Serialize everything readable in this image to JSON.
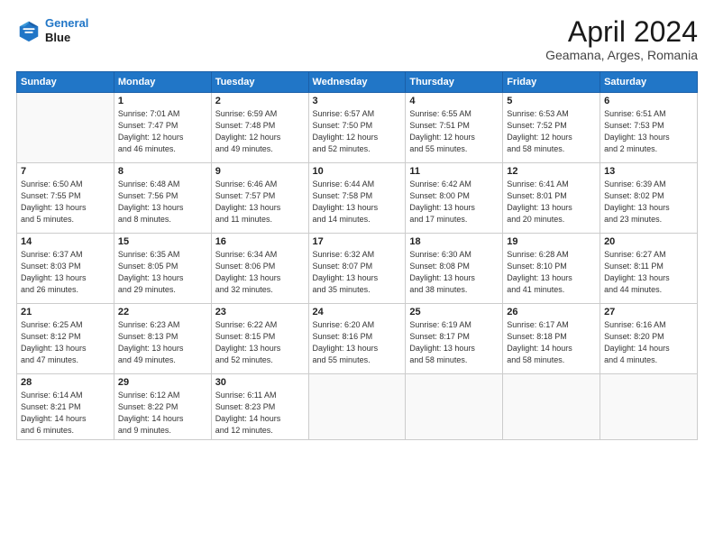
{
  "header": {
    "logo_line1": "General",
    "logo_line2": "Blue",
    "title": "April 2024",
    "subtitle": "Geamana, Arges, Romania"
  },
  "days_of_week": [
    "Sunday",
    "Monday",
    "Tuesday",
    "Wednesday",
    "Thursday",
    "Friday",
    "Saturday"
  ],
  "weeks": [
    [
      {
        "day": "",
        "info": ""
      },
      {
        "day": "1",
        "info": "Sunrise: 7:01 AM\nSunset: 7:47 PM\nDaylight: 12 hours\nand 46 minutes."
      },
      {
        "day": "2",
        "info": "Sunrise: 6:59 AM\nSunset: 7:48 PM\nDaylight: 12 hours\nand 49 minutes."
      },
      {
        "day": "3",
        "info": "Sunrise: 6:57 AM\nSunset: 7:50 PM\nDaylight: 12 hours\nand 52 minutes."
      },
      {
        "day": "4",
        "info": "Sunrise: 6:55 AM\nSunset: 7:51 PM\nDaylight: 12 hours\nand 55 minutes."
      },
      {
        "day": "5",
        "info": "Sunrise: 6:53 AM\nSunset: 7:52 PM\nDaylight: 12 hours\nand 58 minutes."
      },
      {
        "day": "6",
        "info": "Sunrise: 6:51 AM\nSunset: 7:53 PM\nDaylight: 13 hours\nand 2 minutes."
      }
    ],
    [
      {
        "day": "7",
        "info": "Sunrise: 6:50 AM\nSunset: 7:55 PM\nDaylight: 13 hours\nand 5 minutes."
      },
      {
        "day": "8",
        "info": "Sunrise: 6:48 AM\nSunset: 7:56 PM\nDaylight: 13 hours\nand 8 minutes."
      },
      {
        "day": "9",
        "info": "Sunrise: 6:46 AM\nSunset: 7:57 PM\nDaylight: 13 hours\nand 11 minutes."
      },
      {
        "day": "10",
        "info": "Sunrise: 6:44 AM\nSunset: 7:58 PM\nDaylight: 13 hours\nand 14 minutes."
      },
      {
        "day": "11",
        "info": "Sunrise: 6:42 AM\nSunset: 8:00 PM\nDaylight: 13 hours\nand 17 minutes."
      },
      {
        "day": "12",
        "info": "Sunrise: 6:41 AM\nSunset: 8:01 PM\nDaylight: 13 hours\nand 20 minutes."
      },
      {
        "day": "13",
        "info": "Sunrise: 6:39 AM\nSunset: 8:02 PM\nDaylight: 13 hours\nand 23 minutes."
      }
    ],
    [
      {
        "day": "14",
        "info": "Sunrise: 6:37 AM\nSunset: 8:03 PM\nDaylight: 13 hours\nand 26 minutes."
      },
      {
        "day": "15",
        "info": "Sunrise: 6:35 AM\nSunset: 8:05 PM\nDaylight: 13 hours\nand 29 minutes."
      },
      {
        "day": "16",
        "info": "Sunrise: 6:34 AM\nSunset: 8:06 PM\nDaylight: 13 hours\nand 32 minutes."
      },
      {
        "day": "17",
        "info": "Sunrise: 6:32 AM\nSunset: 8:07 PM\nDaylight: 13 hours\nand 35 minutes."
      },
      {
        "day": "18",
        "info": "Sunrise: 6:30 AM\nSunset: 8:08 PM\nDaylight: 13 hours\nand 38 minutes."
      },
      {
        "day": "19",
        "info": "Sunrise: 6:28 AM\nSunset: 8:10 PM\nDaylight: 13 hours\nand 41 minutes."
      },
      {
        "day": "20",
        "info": "Sunrise: 6:27 AM\nSunset: 8:11 PM\nDaylight: 13 hours\nand 44 minutes."
      }
    ],
    [
      {
        "day": "21",
        "info": "Sunrise: 6:25 AM\nSunset: 8:12 PM\nDaylight: 13 hours\nand 47 minutes."
      },
      {
        "day": "22",
        "info": "Sunrise: 6:23 AM\nSunset: 8:13 PM\nDaylight: 13 hours\nand 49 minutes."
      },
      {
        "day": "23",
        "info": "Sunrise: 6:22 AM\nSunset: 8:15 PM\nDaylight: 13 hours\nand 52 minutes."
      },
      {
        "day": "24",
        "info": "Sunrise: 6:20 AM\nSunset: 8:16 PM\nDaylight: 13 hours\nand 55 minutes."
      },
      {
        "day": "25",
        "info": "Sunrise: 6:19 AM\nSunset: 8:17 PM\nDaylight: 13 hours\nand 58 minutes."
      },
      {
        "day": "26",
        "info": "Sunrise: 6:17 AM\nSunset: 8:18 PM\nDaylight: 14 hours\nand 58 minutes."
      },
      {
        "day": "27",
        "info": "Sunrise: 6:16 AM\nSunset: 8:20 PM\nDaylight: 14 hours\nand 4 minutes."
      }
    ],
    [
      {
        "day": "28",
        "info": "Sunrise: 6:14 AM\nSunset: 8:21 PM\nDaylight: 14 hours\nand 6 minutes."
      },
      {
        "day": "29",
        "info": "Sunrise: 6:12 AM\nSunset: 8:22 PM\nDaylight: 14 hours\nand 9 minutes."
      },
      {
        "day": "30",
        "info": "Sunrise: 6:11 AM\nSunset: 8:23 PM\nDaylight: 14 hours\nand 12 minutes."
      },
      {
        "day": "",
        "info": ""
      },
      {
        "day": "",
        "info": ""
      },
      {
        "day": "",
        "info": ""
      },
      {
        "day": "",
        "info": ""
      }
    ]
  ]
}
